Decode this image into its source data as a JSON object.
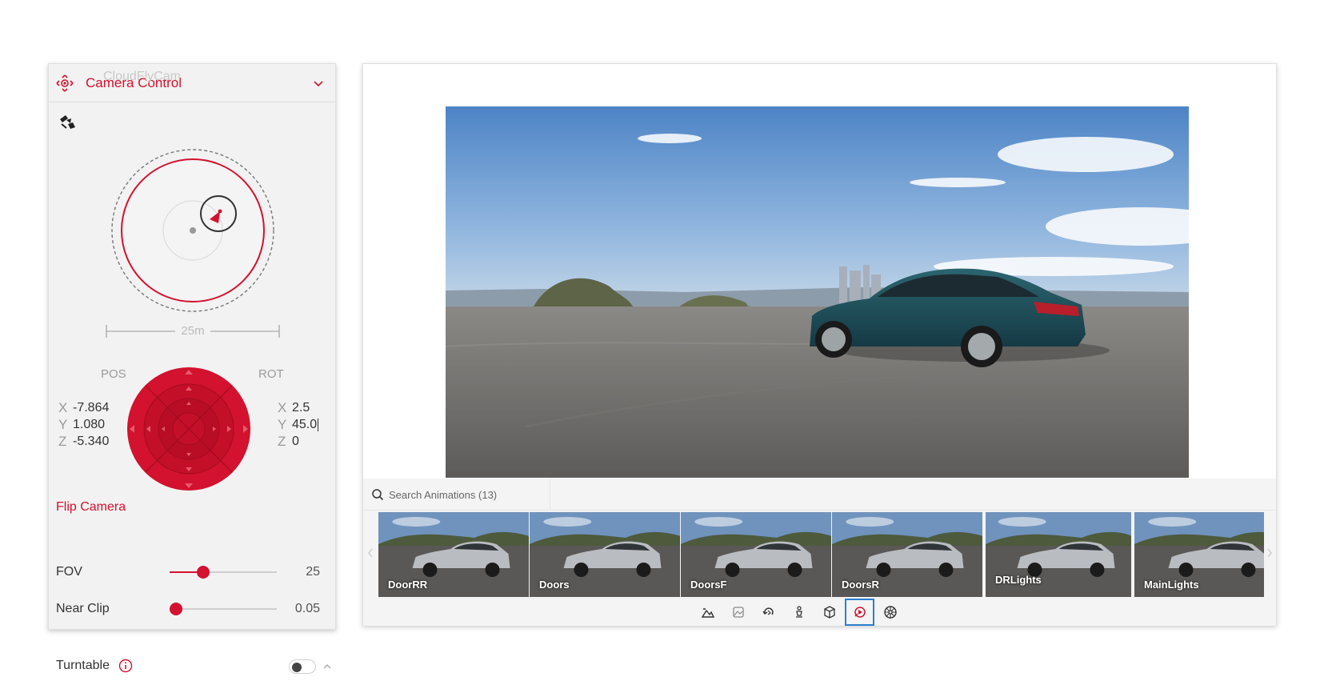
{
  "panel": {
    "title": "Camera Control",
    "camera_name": "CloudFlyCam",
    "distance_label": "25m",
    "pos_label": "POS",
    "rot_label": "ROT",
    "pos": {
      "x": "-7.864",
      "y": "1.080",
      "z": "-5.340"
    },
    "rot": {
      "x": "2.5",
      "y": "45.0",
      "z": "0"
    },
    "axis_names": {
      "x": "X",
      "y": "Y",
      "z": "Z"
    },
    "flip_camera": "Flip Camera",
    "fov": {
      "label": "FOV",
      "value": "25",
      "fraction": 0.31
    },
    "near_clip": {
      "label": "Near Clip",
      "value": "0.05",
      "fraction": 0.06
    },
    "turntable": {
      "label": "Turntable",
      "enabled": false
    }
  },
  "viewer": {
    "search_placeholder": "Search Animations (13)",
    "animations": [
      {
        "label": "DoorRR",
        "selected": false
      },
      {
        "label": "Doors",
        "selected": false
      },
      {
        "label": "DoorsF",
        "selected": false
      },
      {
        "label": "DoorsR",
        "selected": false
      },
      {
        "label": "DRLights",
        "selected": true
      },
      {
        "label": "MainLights",
        "selected": false
      }
    ],
    "toolbar": [
      {
        "icon": "environment-icon",
        "active": false
      },
      {
        "icon": "image-icon",
        "active": false
      },
      {
        "icon": "rotate-icon",
        "active": false
      },
      {
        "icon": "figure-icon",
        "active": false
      },
      {
        "icon": "cube-icon",
        "active": false
      },
      {
        "icon": "animation-icon",
        "active": true
      },
      {
        "icon": "wheel-icon",
        "active": false
      }
    ]
  },
  "colors": {
    "accent": "#d2122e",
    "selection": "#2d7fd0",
    "car_body": "#1e4e5a",
    "thumb_car": "#b9bcc0"
  }
}
